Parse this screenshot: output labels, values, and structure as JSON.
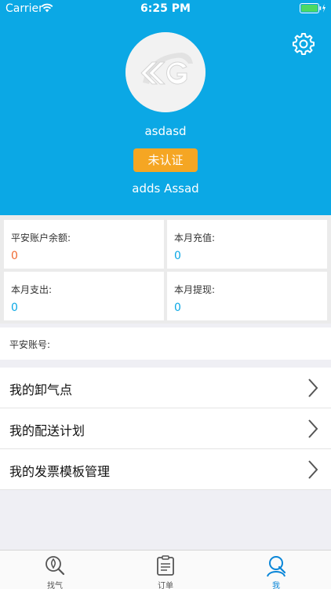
{
  "status_bar": {
    "carrier": "Carrier",
    "time": "6:25 PM"
  },
  "profile": {
    "username": "asdasd",
    "verify_label": "未认证",
    "nickname": "adds Assad"
  },
  "stats": {
    "balance": {
      "label": "平安账户余额:",
      "value": "0"
    },
    "recharge": {
      "label": "本月充值:",
      "value": "0"
    },
    "expense": {
      "label": "本月支出:",
      "value": "0"
    },
    "withdraw": {
      "label": "本月提现:",
      "value": "0"
    }
  },
  "account": {
    "label": "平安账号:"
  },
  "menu": {
    "items": [
      {
        "label": "我的卸气点"
      },
      {
        "label": "我的配送计划"
      },
      {
        "label": "我的发票模板管理"
      }
    ]
  },
  "tabbar": {
    "tabs": [
      {
        "label": "找气"
      },
      {
        "label": "订单"
      },
      {
        "label": "我"
      }
    ]
  },
  "colors": {
    "primary": "#0ba8e5",
    "warning": "#f5a623",
    "balance_value": "#f06a33"
  }
}
